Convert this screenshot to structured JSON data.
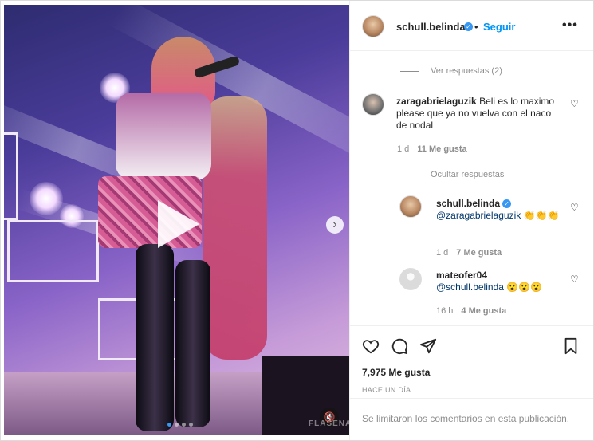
{
  "post": {
    "username": "schull.belinda",
    "verified_icon": "verified-badge-icon",
    "separator": "•",
    "follow_label": "Seguir",
    "more_icon": "more-options-icon",
    "more_glyph": "•••"
  },
  "media": {
    "play_icon": "play-icon",
    "next_icon": "chevron-right-icon",
    "next_glyph": "›",
    "mute_icon": "muted-speaker-icon",
    "mute_glyph": "🔇",
    "watermark": "FLASENAL",
    "carousel_dots": 4,
    "active_dot": 0
  },
  "comments": {
    "view_replies": "Ver respuestas (2)",
    "main": {
      "username": "zaragabrielaguzik",
      "text": "Beli es lo maximo please que ya no vuelva con el naco de nodal",
      "time": "1 d",
      "likes": "11 Me gusta"
    },
    "hide_replies": "Ocultar respuestas",
    "replies": [
      {
        "username": "schull.belinda",
        "mention": "@zaragabrielaguzik",
        "emoji": "👏👏👏",
        "time": "1 d",
        "likes": "7 Me gusta"
      },
      {
        "username": "mateofer04",
        "mention": "@schull.belinda",
        "emoji": "😮😮😮",
        "time": "16 h",
        "likes": "4 Me gusta"
      }
    ]
  },
  "actions": {
    "like_icon": "heart-icon",
    "comment_icon": "comment-bubble-icon",
    "share_icon": "paper-plane-icon",
    "save_icon": "bookmark-icon",
    "likes": "7,975 Me gusta",
    "timestamp": "HACE UN DÍA",
    "comments_limited": "Se limitaron los comentarios en esta publicación."
  },
  "colors": {
    "link_blue": "#0095f6",
    "text": "#262626",
    "muted": "#8e8e8e",
    "border": "#efefef"
  }
}
